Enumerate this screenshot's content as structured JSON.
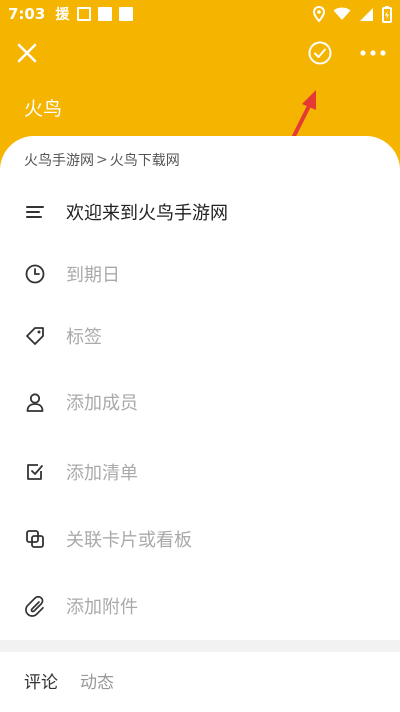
{
  "status_bar": {
    "time": "7:03",
    "app_glyph": "援",
    "icons": [
      "location-icon",
      "wifi-icon",
      "signal-icon",
      "battery-icon"
    ]
  },
  "header": {
    "title": "火鸟",
    "background_color": "#f4b400",
    "annotation_color": "#e53935"
  },
  "breadcrumb": {
    "parts": [
      "火鸟手游网",
      "火鸟下载网"
    ],
    "separator": ">"
  },
  "menu": [
    {
      "icon": "description-icon",
      "label": "欢迎来到火鸟手游网"
    },
    {
      "icon": "clock-icon",
      "label": "到期日"
    },
    {
      "icon": "tag-icon",
      "label": "标签"
    },
    {
      "icon": "person-icon",
      "label": "添加成员"
    },
    {
      "icon": "checklist-icon",
      "label": "添加清单"
    },
    {
      "icon": "link-card-icon",
      "label": "关联卡片或看板"
    },
    {
      "icon": "paperclip-icon",
      "label": "添加附件"
    }
  ],
  "tabs": [
    {
      "label": "评论"
    },
    {
      "label": "动态"
    }
  ]
}
